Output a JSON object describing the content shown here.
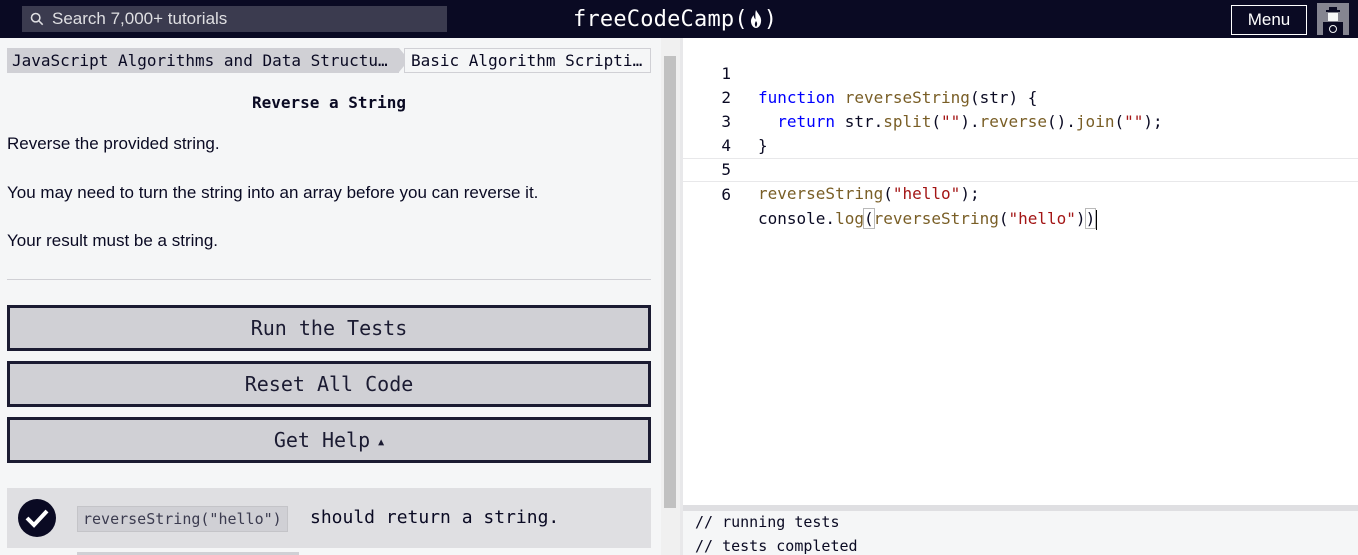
{
  "nav": {
    "search_placeholder": "Search 7,000+ tutorials",
    "logo_text_left": "freeCodeCamp(",
    "logo_text_right": ")",
    "menu_label": "Menu"
  },
  "breadcrumbs": [
    "JavaScript Algorithms and Data Structures",
    "Basic Algorithm Scripting"
  ],
  "challenge": {
    "title": "Reverse a String",
    "description": [
      "Reverse the provided string.",
      "You may need to turn the string into an array before you can reverse it.",
      "Your result must be a string."
    ]
  },
  "buttons": {
    "run_tests": "Run the Tests",
    "reset_code": "Reset All Code",
    "get_help": "Get Help",
    "get_help_caret": "▲"
  },
  "tests": [
    {
      "code": "reverseString(\"hello\")",
      "text": "should return a string.",
      "passed": true
    }
  ],
  "editor": {
    "line_numbers": [
      "1",
      "2",
      "3",
      "4",
      "5",
      "6"
    ],
    "active_line": 6
  },
  "console": {
    "lines": [
      "// running tests",
      "// tests completed"
    ]
  },
  "colors": {
    "nav_bg": "#0a0a23",
    "panel_bg": "#f5f6f7",
    "button_bg": "#d0d0d5",
    "keyword": "#0000ff",
    "string": "#a31515",
    "function": "#795e26"
  }
}
